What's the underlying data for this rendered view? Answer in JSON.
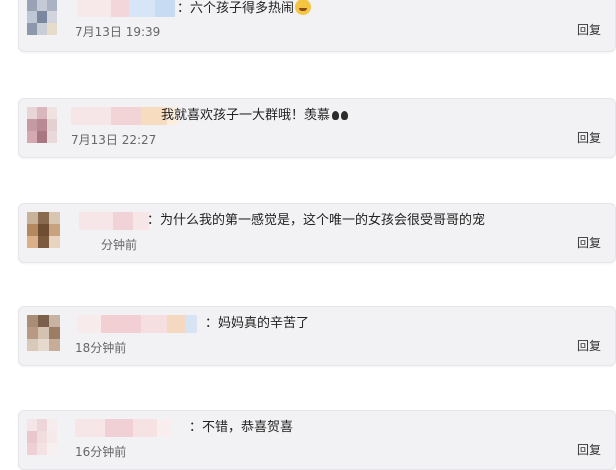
{
  "comments": [
    {
      "text": "：六个孩子得多热闹",
      "time": "7月13日 19:39",
      "reply": "回复"
    },
    {
      "text": "我就喜欢孩子一大群哦！羡慕",
      "time": "7月13日 22:27",
      "reply": "回复"
    },
    {
      "text": "：为什么我的第一感觉是，这个唯一的女孩会很受哥哥的宠",
      "time": "分钟前",
      "reply": "回复"
    },
    {
      "text": "：妈妈真的辛苦了",
      "time": "18分钟前",
      "reply": "回复"
    },
    {
      "text": "：不错，恭喜贺喜",
      "time": "16分钟前",
      "reply": "回复"
    }
  ],
  "icons": {
    "laugh_cry": "laugh-cry-emoji-icon",
    "clap": "clap-emoji-icon"
  }
}
